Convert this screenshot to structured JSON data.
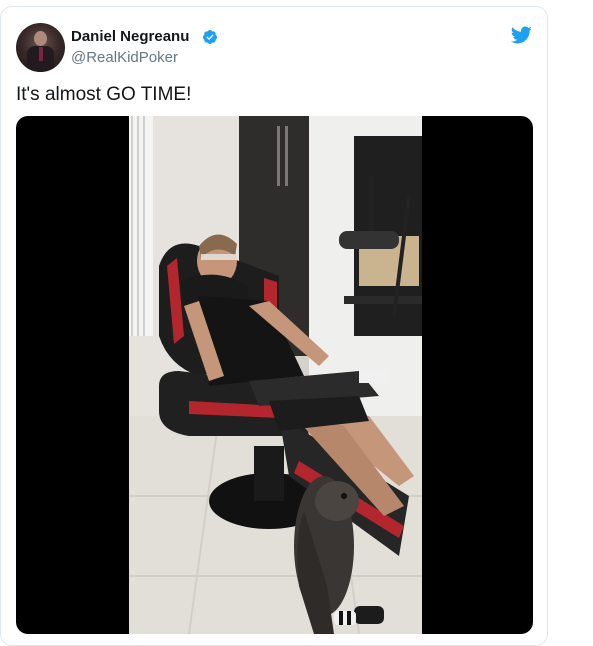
{
  "tweet": {
    "author_name": "Daniel Negreanu",
    "author_handle": "@RealKidPoker",
    "verified": true,
    "text": "It's almost GO TIME!",
    "media_type": "video"
  },
  "icons": {
    "avatar": "avatar",
    "verified": "verified-badge-icon",
    "brand": "twitter-bird-icon"
  },
  "colors": {
    "brand_blue": "#1da1f2",
    "name_text": "#14171a",
    "handle_text": "#657786",
    "card_border": "#e1e8ed",
    "media_background": "#000000"
  }
}
